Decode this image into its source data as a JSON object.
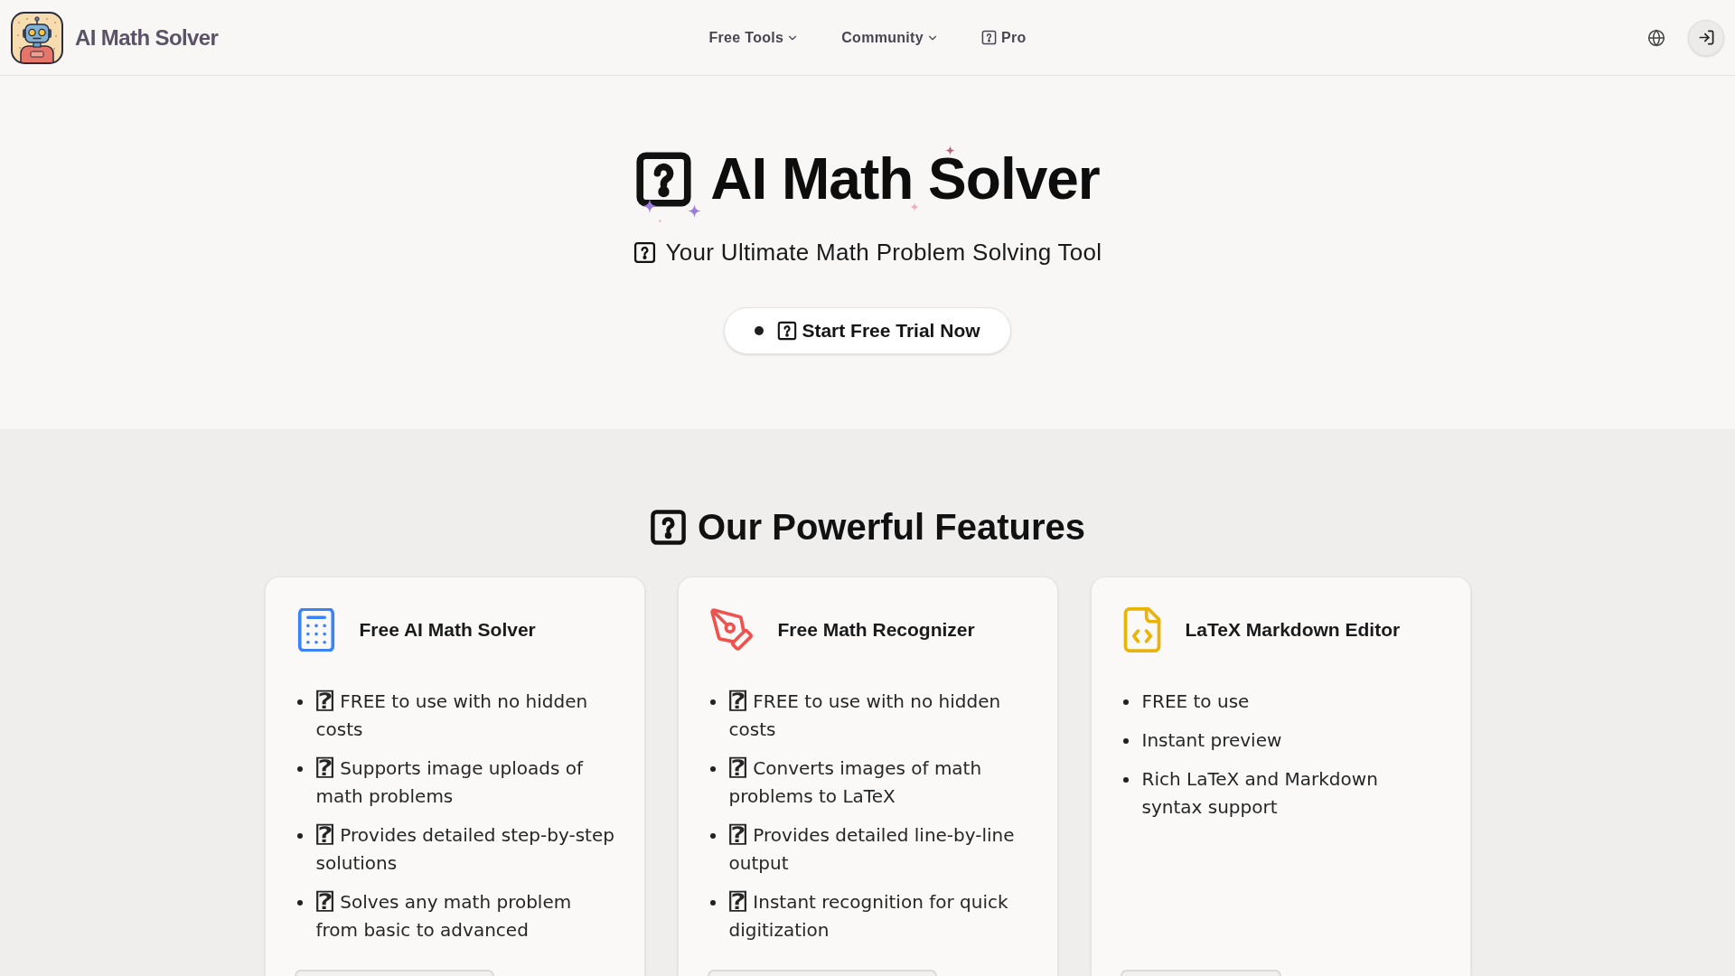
{
  "header": {
    "logo": {
      "text": "AI Math Solver"
    },
    "nav": [
      {
        "label": "Free Tools",
        "kind": "dropdown"
      },
      {
        "label": "Community",
        "kind": "dropdown"
      },
      {
        "label": "Pro",
        "kind": "link"
      }
    ]
  },
  "hero": {
    "title": "AI Math Solver",
    "subtitle": "Your Ultimate Math Problem Solving Tool",
    "cta": "Start Free Trial Now"
  },
  "features": {
    "heading": "Our Powerful Features",
    "cards": [
      {
        "title": "Free AI Math Solver",
        "color": "#3b82f6",
        "items": [
          {
            "prefix": "⍰",
            "text": "FREE to use with no hidden costs"
          },
          {
            "prefix": "⍰",
            "text": "Supports image uploads of math problems"
          },
          {
            "prefix": "⍰",
            "text": "Provides detailed step-by-step solutions"
          },
          {
            "prefix": "⍰",
            "text": "Solves any math problem from basic to advanced"
          }
        ]
      },
      {
        "title": "Free Math Recognizer",
        "color": "#ef5350",
        "items": [
          {
            "prefix": "⍰",
            "text": "FREE to use with no hidden costs"
          },
          {
            "prefix": "⍰",
            "text": "Converts images of math problems to LaTeX"
          },
          {
            "prefix": "⍰",
            "text": "Provides detailed line-by-line output"
          },
          {
            "prefix": "⍰",
            "text": "Instant recognition for quick digitization"
          }
        ]
      },
      {
        "title": "LaTeX Markdown Editor",
        "color": "#eab308",
        "items": [
          {
            "text": "FREE to use"
          },
          {
            "text": "Instant preview"
          },
          {
            "text": "Rich LaTeX and Markdown syntax support"
          }
        ]
      }
    ]
  }
}
